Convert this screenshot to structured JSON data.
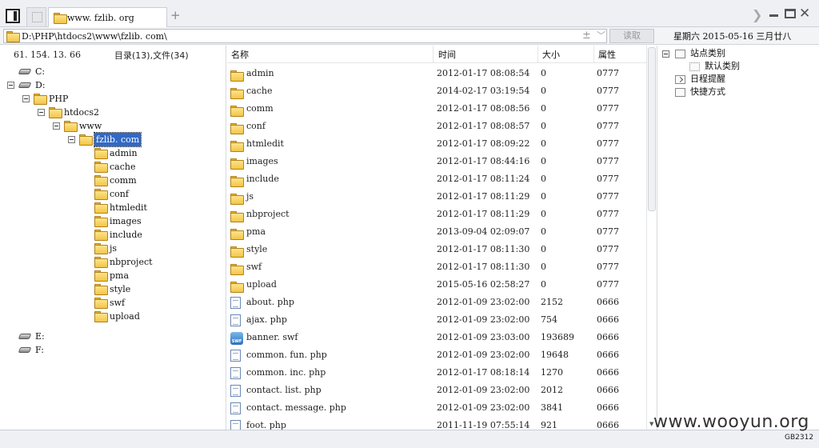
{
  "tab": {
    "title": "www. fzlib. org"
  },
  "address": {
    "path": "D:\\PHP\\htdocs2\\www\\fzlib. com\\",
    "plus": "±",
    "read_button": "读取"
  },
  "date_text": "星期六 2015-05-16 三月廿八",
  "left": {
    "ip": "61. 154. 13. 66",
    "counts": "目录(13),文件(34)",
    "tree": [
      {
        "label": "C:",
        "kind": "drive",
        "level": 0,
        "expanded": false
      },
      {
        "label": "D:",
        "kind": "drive",
        "level": 0,
        "expanded": true
      },
      {
        "label": "PHP",
        "kind": "folder",
        "level": 1,
        "expanded": true
      },
      {
        "label": "htdocs2",
        "kind": "folder",
        "level": 2,
        "expanded": true
      },
      {
        "label": "www",
        "kind": "folder",
        "level": 3,
        "expanded": true
      },
      {
        "label": "fzlib. com",
        "kind": "folder",
        "level": 4,
        "expanded": true,
        "selected": true
      },
      {
        "label": "admin",
        "kind": "folder",
        "level": 5
      },
      {
        "label": "cache",
        "kind": "folder",
        "level": 5
      },
      {
        "label": "comm",
        "kind": "folder",
        "level": 5
      },
      {
        "label": "conf",
        "kind": "folder",
        "level": 5
      },
      {
        "label": "htmledit",
        "kind": "folder",
        "level": 5
      },
      {
        "label": "images",
        "kind": "folder",
        "level": 5
      },
      {
        "label": "include",
        "kind": "folder",
        "level": 5
      },
      {
        "label": "js",
        "kind": "folder",
        "level": 5
      },
      {
        "label": "nbproject",
        "kind": "folder",
        "level": 5
      },
      {
        "label": "pma",
        "kind": "folder",
        "level": 5
      },
      {
        "label": "style",
        "kind": "folder",
        "level": 5
      },
      {
        "label": "swf",
        "kind": "folder",
        "level": 5
      },
      {
        "label": "upload",
        "kind": "folder",
        "level": 5
      },
      {
        "label": "E:",
        "kind": "drive",
        "level": 0,
        "expanded": false
      },
      {
        "label": "F:",
        "kind": "drive",
        "level": 0,
        "expanded": false
      }
    ]
  },
  "list": {
    "headers": {
      "name": "名称",
      "time": "时间",
      "size": "大小",
      "attr": "属性"
    },
    "rows": [
      {
        "icon": "folder-icon",
        "name": "admin",
        "time": "2012-01-17 08:08:54",
        "size": "0",
        "attr": "0777"
      },
      {
        "icon": "folder-icon",
        "name": "cache",
        "time": "2014-02-17 03:19:54",
        "size": "0",
        "attr": "0777"
      },
      {
        "icon": "folder-icon",
        "name": "comm",
        "time": "2012-01-17 08:08:56",
        "size": "0",
        "attr": "0777"
      },
      {
        "icon": "folder-icon",
        "name": "conf",
        "time": "2012-01-17 08:08:57",
        "size": "0",
        "attr": "0777"
      },
      {
        "icon": "folder-icon",
        "name": "htmledit",
        "time": "2012-01-17 08:09:22",
        "size": "0",
        "attr": "0777"
      },
      {
        "icon": "folder-icon",
        "name": "images",
        "time": "2012-01-17 08:44:16",
        "size": "0",
        "attr": "0777"
      },
      {
        "icon": "folder-icon",
        "name": "include",
        "time": "2012-01-17 08:11:24",
        "size": "0",
        "attr": "0777"
      },
      {
        "icon": "folder-icon",
        "name": "js",
        "time": "2012-01-17 08:11:29",
        "size": "0",
        "attr": "0777"
      },
      {
        "icon": "folder-icon",
        "name": "nbproject",
        "time": "2012-01-17 08:11:29",
        "size": "0",
        "attr": "0777"
      },
      {
        "icon": "folder-icon",
        "name": "pma",
        "time": "2013-09-04 02:09:07",
        "size": "0",
        "attr": "0777"
      },
      {
        "icon": "folder-icon",
        "name": "style",
        "time": "2012-01-17 08:11:30",
        "size": "0",
        "attr": "0777"
      },
      {
        "icon": "folder-icon",
        "name": "swf",
        "time": "2012-01-17 08:11:30",
        "size": "0",
        "attr": "0777"
      },
      {
        "icon": "folder-icon",
        "name": "upload",
        "time": "2015-05-16 02:58:27",
        "size": "0",
        "attr": "0777"
      },
      {
        "icon": "php-file-icon",
        "name": "about. php",
        "time": "2012-01-09 23:02:00",
        "size": "2152",
        "attr": "0666"
      },
      {
        "icon": "php-file-icon",
        "name": "ajax. php",
        "time": "2012-01-09 23:02:00",
        "size": "754",
        "attr": "0666"
      },
      {
        "icon": "swf-file-icon",
        "name": "banner. swf",
        "time": "2012-01-09 23:03:00",
        "size": "193689",
        "attr": "0666"
      },
      {
        "icon": "php-file-icon",
        "name": "common. fun. php",
        "time": "2012-01-09 23:02:00",
        "size": "19648",
        "attr": "0666"
      },
      {
        "icon": "php-file-icon",
        "name": "common. inc. php",
        "time": "2012-01-17 08:18:14",
        "size": "1270",
        "attr": "0666"
      },
      {
        "icon": "php-file-icon",
        "name": "contact. list. php",
        "time": "2012-01-09 23:02:00",
        "size": "2012",
        "attr": "0666"
      },
      {
        "icon": "php-file-icon",
        "name": "contact. message. php",
        "time": "2012-01-09 23:02:00",
        "size": "3841",
        "attr": "0666"
      },
      {
        "icon": "php-file-icon",
        "name": "foot. php",
        "time": "2011-11-19 07:55:14",
        "size": "921",
        "attr": "0666"
      }
    ]
  },
  "right": {
    "items": [
      {
        "label": "站点类别",
        "icon": "category-icon",
        "indent": 0,
        "expander": true
      },
      {
        "label": "默认类别",
        "icon": "default-category-icon",
        "indent": 1
      },
      {
        "label": "日程提醒",
        "icon": "calendar-icon",
        "indent": 0
      },
      {
        "label": "快捷方式",
        "icon": "shortcut-icon",
        "indent": 0
      }
    ]
  },
  "watermark": "www.wooyun.org",
  "encoding": "GB2312"
}
